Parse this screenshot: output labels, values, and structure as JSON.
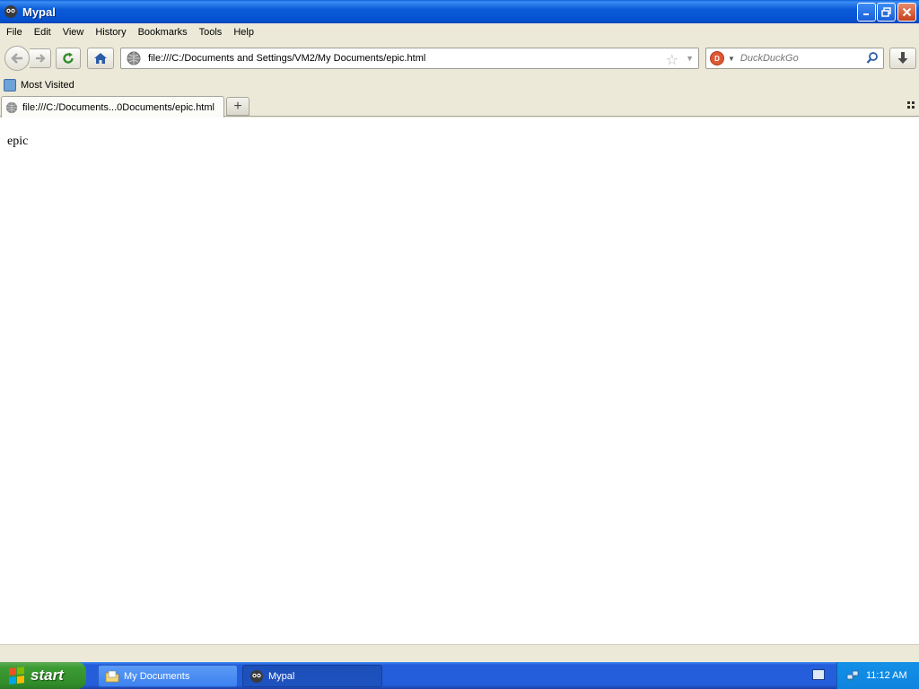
{
  "window": {
    "title": "Mypal",
    "controls": {
      "minimize": "minimize",
      "maximize": "restore",
      "close": "close"
    }
  },
  "menu": {
    "items": [
      "File",
      "Edit",
      "View",
      "History",
      "Bookmarks",
      "Tools",
      "Help"
    ]
  },
  "navigation": {
    "url": "file:///C:/Documents and Settings/VM2/My Documents/epic.html",
    "search_placeholder": "DuckDuckGo",
    "search_engine_icon": "duckduckgo-icon"
  },
  "bookmarks": {
    "items": [
      {
        "label": "Most Visited"
      }
    ]
  },
  "tabs": {
    "items": [
      {
        "label": "file:///C:/Documents...0Documents/epic.html",
        "active": true
      }
    ],
    "new_tab_label": "+"
  },
  "page": {
    "content_text": "epic"
  },
  "taskbar": {
    "start_label": "start",
    "tasks": [
      {
        "label": "My Documents",
        "active": false
      },
      {
        "label": "Mypal",
        "active": true
      }
    ],
    "clock": "11:12 AM"
  },
  "colors": {
    "titlebar": "#0b5bd9",
    "taskbar": "#245edb",
    "start_button": "#3c9c34",
    "chrome": "#ece9d8"
  }
}
